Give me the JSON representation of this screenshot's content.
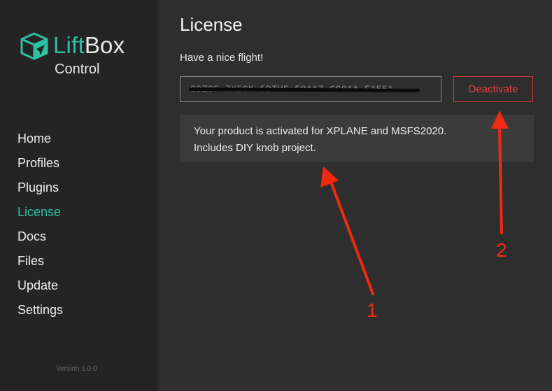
{
  "sidebar": {
    "logo": {
      "part1": "Lift",
      "part2": "Box",
      "subtitle": "Control"
    },
    "items": [
      {
        "label": "Home"
      },
      {
        "label": "Profiles"
      },
      {
        "label": "Plugins"
      },
      {
        "label": "License"
      },
      {
        "label": "Docs"
      },
      {
        "label": "Files"
      },
      {
        "label": "Update"
      },
      {
        "label": "Settings"
      }
    ],
    "active_item": "License",
    "version": "Version 1.0.0"
  },
  "main": {
    "title": "License",
    "subtitle": "Have a nice flight!",
    "license_key": "C9Z3F-7X5CK-5DTVF-E9A17-CG9AA-F1551",
    "deactivate_label": "Deactivate",
    "status_lines": [
      "Your product is activated for XPLANE and MSFS2020.",
      "Includes DIY knob project."
    ]
  },
  "annotations": [
    {
      "label": "1"
    },
    {
      "label": "2"
    }
  ],
  "colors": {
    "accent": "#2ec0a0",
    "danger": "#e04040",
    "annotation": "#f02a12"
  }
}
